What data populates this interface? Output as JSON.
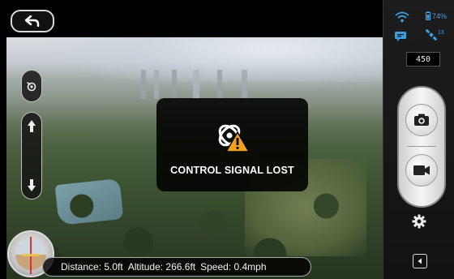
{
  "alert": {
    "message": "CONTROL SIGNAL LOST"
  },
  "status_bar": {
    "distance": "Distance: 5.0ft",
    "altitude": "Altitude: 266.6ft",
    "speed": "Speed: 0.4mph"
  },
  "right_panel": {
    "battery_text": "74%",
    "satellite_count": "13",
    "shot_counter": "450"
  },
  "icons": {
    "back": "back-arrow-icon",
    "alert": "signal-lost-warning-icon",
    "camera": "camera-icon",
    "video": "video-camera-icon",
    "settings": "gear-icon",
    "collapse": "collapse-panel-icon",
    "wifi": "wifi-icon",
    "chat": "chat-icon",
    "satellite": "satellite-icon",
    "battery": "battery-icon"
  },
  "colors": {
    "status_accent": "#3aa0e0",
    "warning": "#f0a020"
  }
}
